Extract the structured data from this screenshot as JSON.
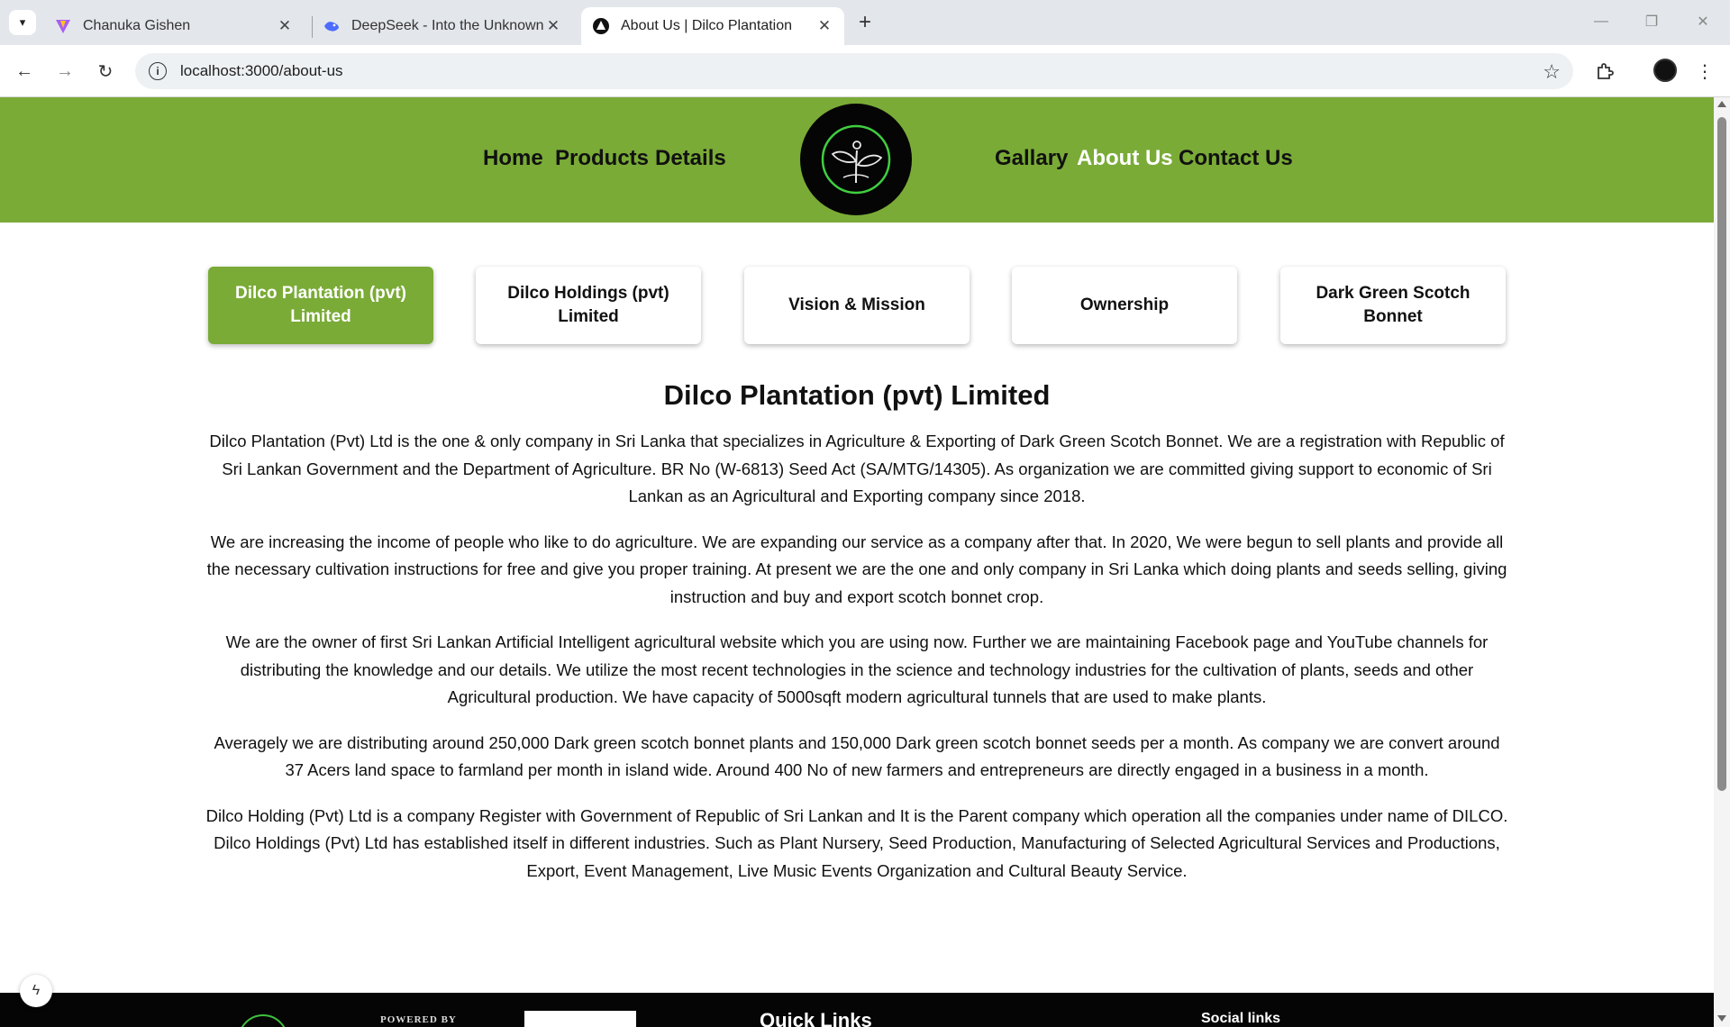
{
  "browser": {
    "tabs": [
      {
        "title": "Chanuka Gishen",
        "favicon": "vite-icon",
        "active": false
      },
      {
        "title": "DeepSeek - Into the Unknown",
        "favicon": "deepseek-icon",
        "active": false
      },
      {
        "title": "About Us | Dilco Plantation",
        "favicon": "site-icon",
        "active": true
      }
    ],
    "close_glyph": "✕",
    "new_tab_glyph": "+",
    "url": "localhost:3000/about-us",
    "window_controls": {
      "minimize": "—",
      "restore": "❐",
      "close": "✕"
    }
  },
  "site": {
    "brand_color": "#7aab37",
    "nav": {
      "left": [
        "Home",
        "Products",
        "Details"
      ],
      "right": [
        "Gallary",
        "About Us",
        "Contact Us"
      ],
      "active": "About Us"
    },
    "section_tabs": [
      {
        "label": "Dilco Plantation (pvt) Limited",
        "active": true
      },
      {
        "label": "Dilco Holdings (pvt) Limited",
        "active": false
      },
      {
        "label": "Vision & Mission",
        "active": false
      },
      {
        "label": "Ownership",
        "active": false
      },
      {
        "label": "Dark Green Scotch Bonnet",
        "active": false
      }
    ],
    "content": {
      "title": "Dilco Plantation (pvt) Limited",
      "paragraphs": [
        "Dilco Plantation (Pvt) Ltd is the one & only company in Sri Lanka that specializes in Agriculture & Exporting of Dark Green Scotch Bonnet. We are a registration with Republic of Sri Lankan Government and the Department of Agriculture. BR No (W-6813) Seed Act (SA/MTG/14305). As organization we are committed giving support to economic of Sri Lankan as an Agricultural and Exporting company since 2018.",
        "We are increasing the income of people who like to do agriculture. We are expanding our service as a company after that. In 2020, We were begun to sell plants and provide all the necessary cultivation instructions for free and give you proper training. At present we are the one and only company in Sri Lanka which doing plants and seeds selling, giving instruction and buy and export scotch bonnet crop.",
        "We are the owner of first Sri Lankan Artificial Intelligent agricultural website which you are using now. Further we are maintaining Facebook page and YouTube channels for distributing the knowledge and our details. We utilize the most recent technologies in the science and technology industries for the cultivation of plants, seeds and other Agricultural production. We have capacity of 5000sqft modern agricultural tunnels that are used to make plants.",
        "Averagely we are distributing around 250,000 Dark green scotch bonnet plants and 150,000 Dark green scotch bonnet seeds per a month. As company we are convert around 37 Acers land space to farmland per month in island wide. Around 400 No of new farmers and entrepreneurs are directly engaged in a business in a month.",
        "Dilco Holding (Pvt) Ltd is a company Register with Government of Republic of Sri Lankan and It is the Parent company which operation all the companies under name of DILCO. Dilco Holdings (Pvt) Ltd has established itself in different industries. Such as Plant Nursery, Seed Production, Manufacturing of Selected Agricultural Services and Productions, Export, Event Management, Live Music Events Organization and Cultural Beauty Service."
      ]
    },
    "footer": {
      "powered_by": "POWERED BY",
      "quick_links": "Quick Links",
      "social_links": "Social links"
    }
  }
}
